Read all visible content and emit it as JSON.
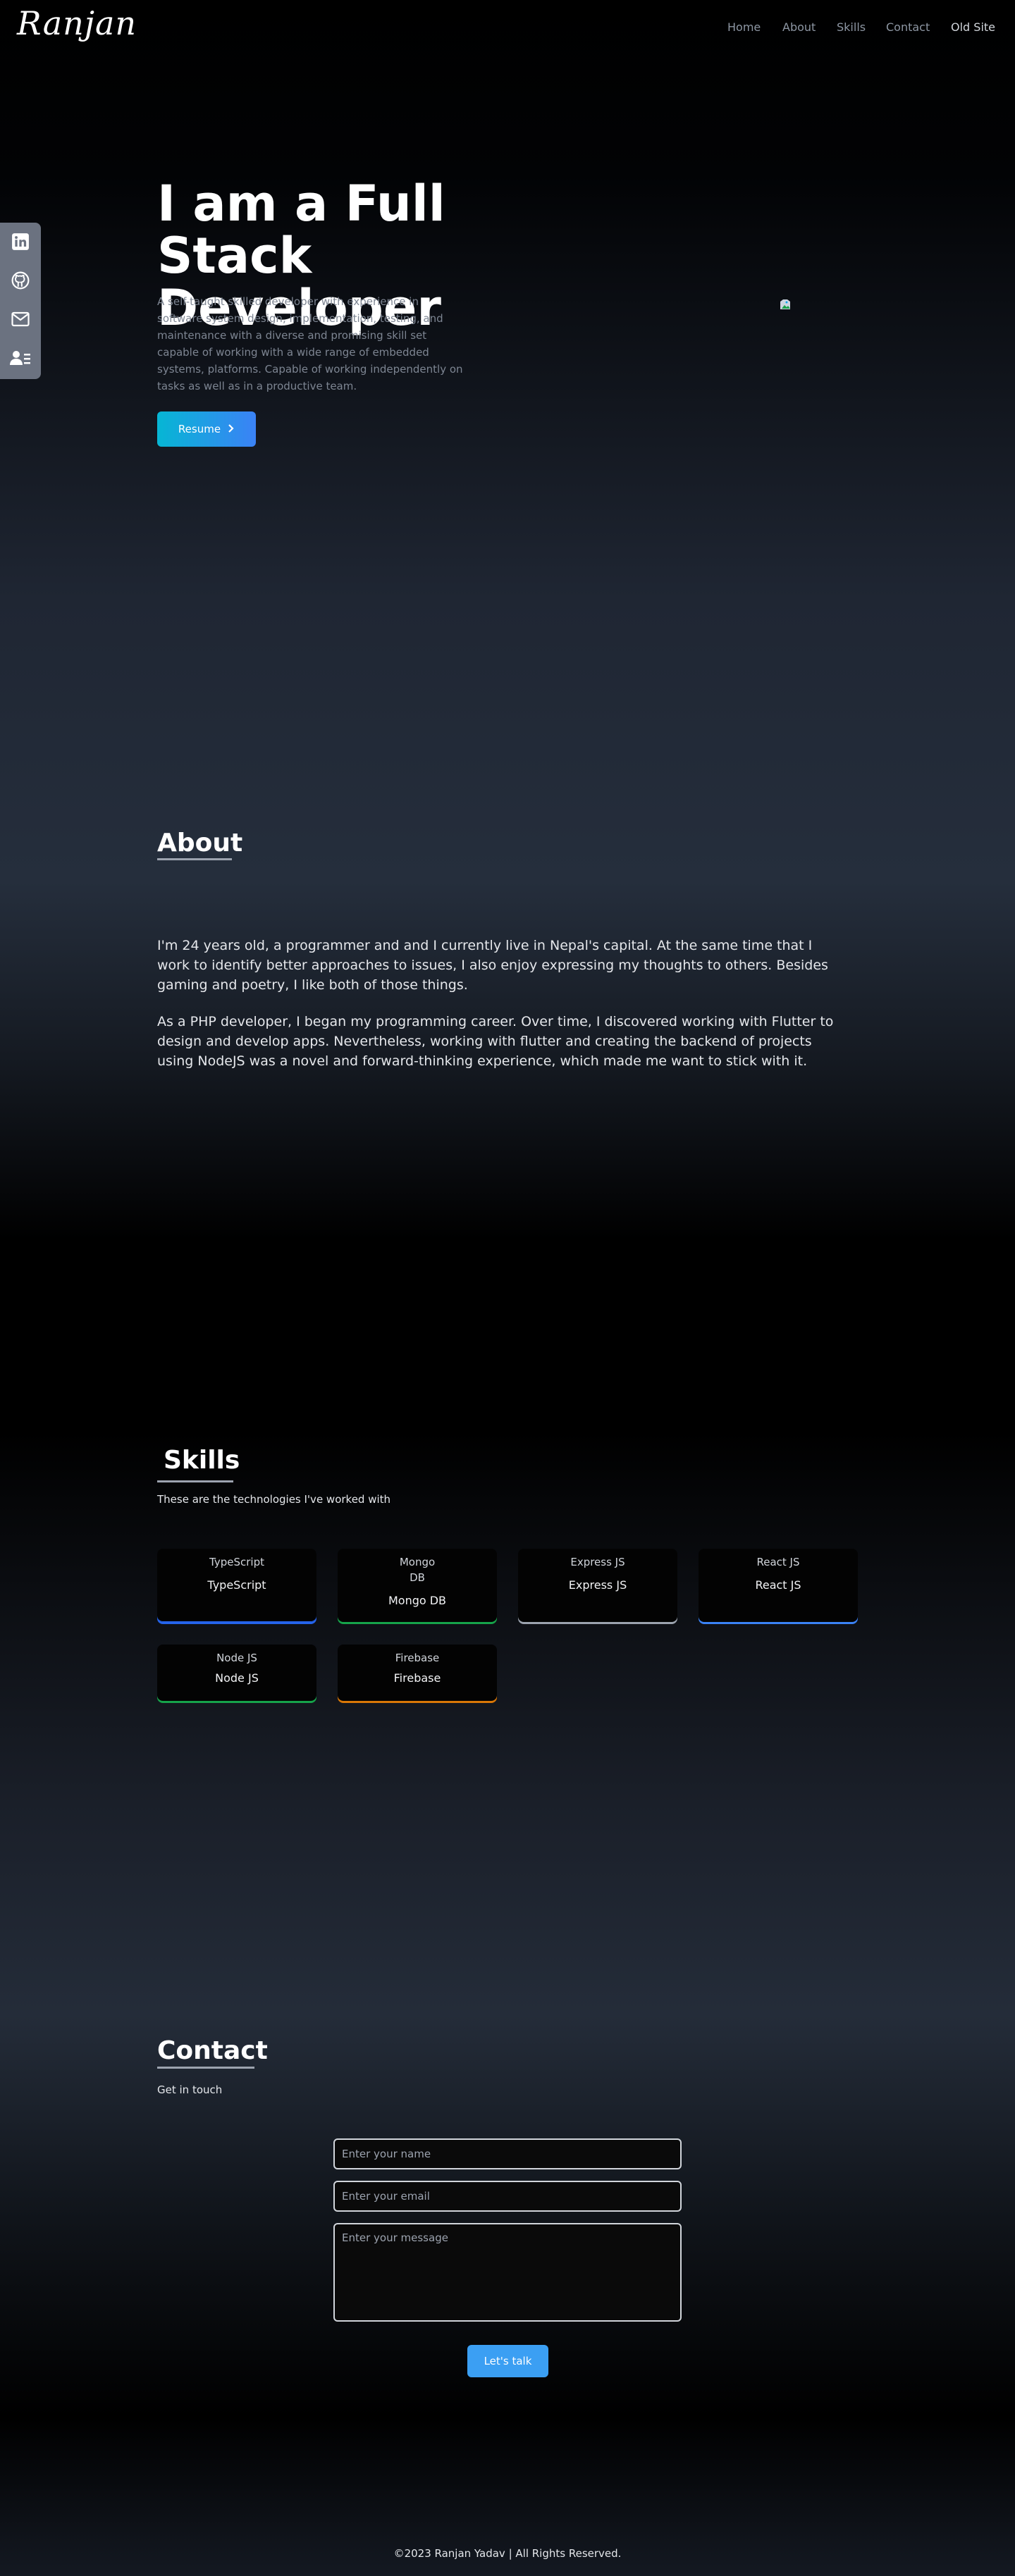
{
  "header": {
    "logo": "Ranjan",
    "nav": [
      "Home",
      "About",
      "Skills",
      "Contact",
      "Old Site"
    ]
  },
  "social": {
    "icons": [
      "linkedin-icon",
      "github-icon",
      "mail-icon",
      "contact-card-icon"
    ]
  },
  "hero": {
    "title_line1": "I am a Full Stack",
    "title_line2": "Developer",
    "description": "A self-taught skilled developer with experience in software system design, implementation, testing, and maintenance with a diverse and promising skill set capable of working with a wide range of embedded systems, platforms. Capable of working independently on tasks as well as in a productive team.",
    "resume_label": "Resume"
  },
  "about": {
    "heading": "About",
    "paragraph1": "I'm 24 years old, a programmer and and I currently live in Nepal's capital. At the same time that I work to identify better approaches to issues, I also enjoy expressing my thoughts to others. Besides gaming and poetry, I like both of those things.",
    "paragraph2": "As a PHP developer, I began my programming career. Over time, I discovered working with Flutter to design and develop apps. Nevertheless, working with flutter and creating the backend of projects using NodeJS was a novel and forward-thinking experience, which made me want to stick with it."
  },
  "skills": {
    "heading": "Skills",
    "subtitle": "These are the technologies I've worked with",
    "cards": [
      {
        "alt": "TypeScript",
        "label": "TypeScript",
        "accent": "#2563eb"
      },
      {
        "alt": "Mongo DB",
        "label": "Mongo DB",
        "accent": "#16a34a"
      },
      {
        "alt": "Express JS",
        "label": "Express JS",
        "accent": "#9ca3af"
      },
      {
        "alt": "React JS",
        "label": "React JS",
        "accent": "#3b82f6"
      },
      {
        "alt": "Node JS",
        "label": "Node JS",
        "accent": "#16a34a"
      },
      {
        "alt": "Firebase",
        "label": "Firebase",
        "accent": "#d97706"
      }
    ]
  },
  "contact": {
    "heading": "Contact",
    "subtitle": "Get in touch",
    "name_placeholder": "Enter your name",
    "email_placeholder": "Enter your email",
    "message_placeholder": "Enter your message",
    "submit_label": "Let's talk"
  },
  "footer": {
    "text": "©2023 Ranjan Yadav | All Rights Reserved."
  }
}
